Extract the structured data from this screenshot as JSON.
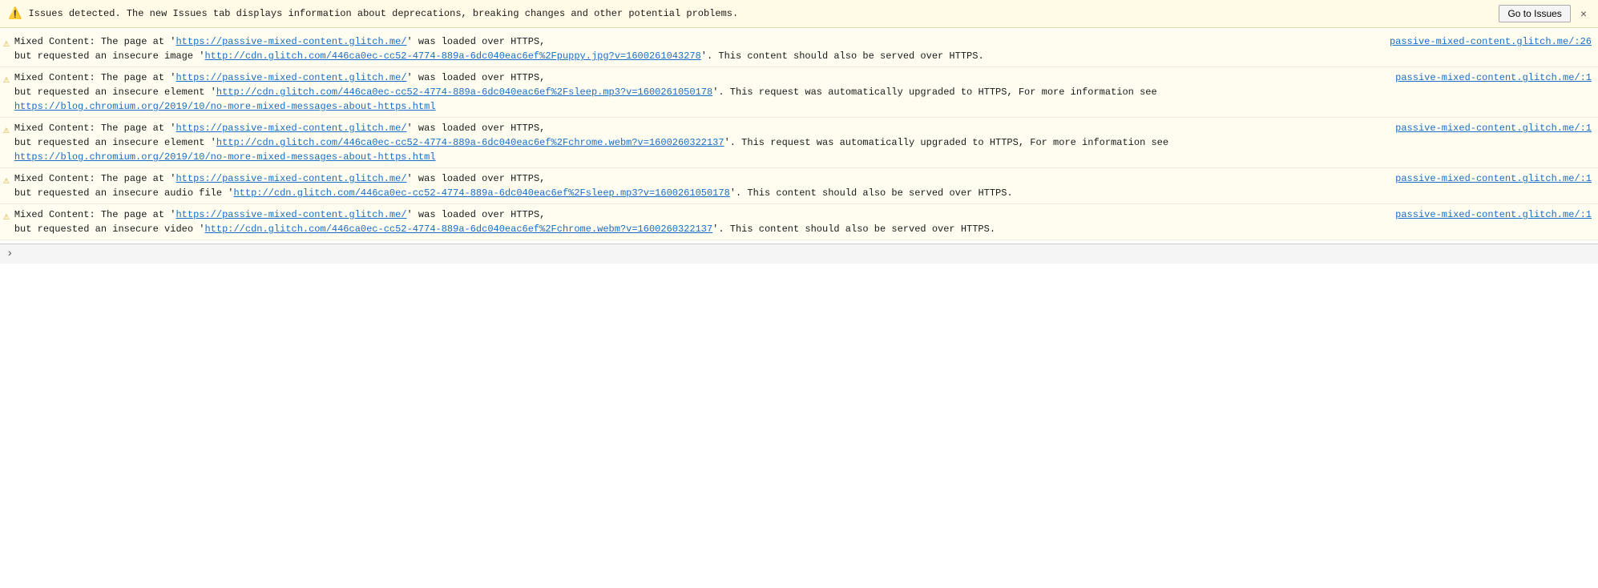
{
  "banner": {
    "icon": "⚠",
    "text": "Issues detected. The new Issues tab displays information about deprecations, breaking changes and other potential problems.",
    "go_to_issues_label": "Go to Issues",
    "close_label": "×"
  },
  "entries": [
    {
      "id": 1,
      "icon": "⚠",
      "line_ref": "passive-mixed-content.glitch.me/:26",
      "message_before": "Mixed Content: The page at '",
      "page_url": "https://passive-mixed-content.glitch.me/",
      "message_mid": "' was loaded over HTTPS,",
      "message_after": " but requested an insecure image '",
      "resource_url": "http://cdn.glitch.com/446ca0ec-cc52-4774-889a-6dc040eac6ef%2Fpuppy.jpg?v=1600261043278",
      "message_end": "'. This content should also be served over HTTPS.",
      "extra_lines": []
    },
    {
      "id": 2,
      "icon": "⚠",
      "line_ref": "passive-mixed-content.glitch.me/:1",
      "message_before": "Mixed Content: The page at '",
      "page_url": "https://passive-mixed-content.glitch.me/",
      "message_mid": "' was loaded over HTTPS,",
      "message_after": " but requested an insecure element '",
      "resource_url": "http://cdn.glitch.com/446ca0ec-cc52-4774-889a-6dc040eac6ef%2Fsleep.mp3?v=1600261050178",
      "message_end": "'. This request was automatically upgraded to HTTPS, For more information see",
      "blog_url": "https://blog.chromium.org/2019/10/no-more-mixed-messages-about-https.html",
      "blog_label": "https://blog.chromium.org/2019/10/no-more-mixed-messages-about-https.html",
      "extra_lines": []
    },
    {
      "id": 3,
      "icon": "⚠",
      "line_ref": "passive-mixed-content.glitch.me/:1",
      "message_before": "Mixed Content: The page at '",
      "page_url": "https://passive-mixed-content.glitch.me/",
      "message_mid": "' was loaded over HTTPS,",
      "message_after": " but requested an insecure element '",
      "resource_url": "http://cdn.glitch.com/446ca0ec-cc52-4774-889a-6dc040eac6ef%2Fchrome.webm?v=1600260322137",
      "message_end": "'. This request was automatically upgraded to HTTPS, For more information see",
      "blog_url": "https://blog.chromium.org/2019/10/no-more-mixed-messages-about-https.html",
      "blog_label": "https://blog.chromium.org/2019/10/no-more-mixed-messages-about-https.html",
      "extra_lines": []
    },
    {
      "id": 4,
      "icon": "⚠",
      "line_ref": "passive-mixed-content.glitch.me/:1",
      "message_before": "Mixed Content: The page at '",
      "page_url": "https://passive-mixed-content.glitch.me/",
      "message_mid": "' was loaded over HTTPS,",
      "message_after": " but requested an insecure audio file '",
      "resource_url": "http://cdn.glitch.com/446ca0ec-cc52-4774-889a-6dc040eac6ef%2Fsleep.mp3?v=1600261050178",
      "message_end": "'. This content should also be served over HTTPS.",
      "extra_lines": []
    },
    {
      "id": 5,
      "icon": "⚠",
      "line_ref": "passive-mixed-content.glitch.me/:1",
      "message_before": "Mixed Content: The page at '",
      "page_url": "https://passive-mixed-content.glitch.me/",
      "message_mid": "' was loaded over HTTPS,",
      "message_after": " but requested an insecure video '",
      "resource_url": "http://cdn.glitch.com/446ca0ec-cc52-4774-889a-6dc040eac6ef%2Fchrome.webm?v=1600260322137",
      "message_end": "'. This content should also be served over HTTPS.",
      "extra_lines": []
    }
  ],
  "bottom_bar": {
    "chevron": "›"
  }
}
